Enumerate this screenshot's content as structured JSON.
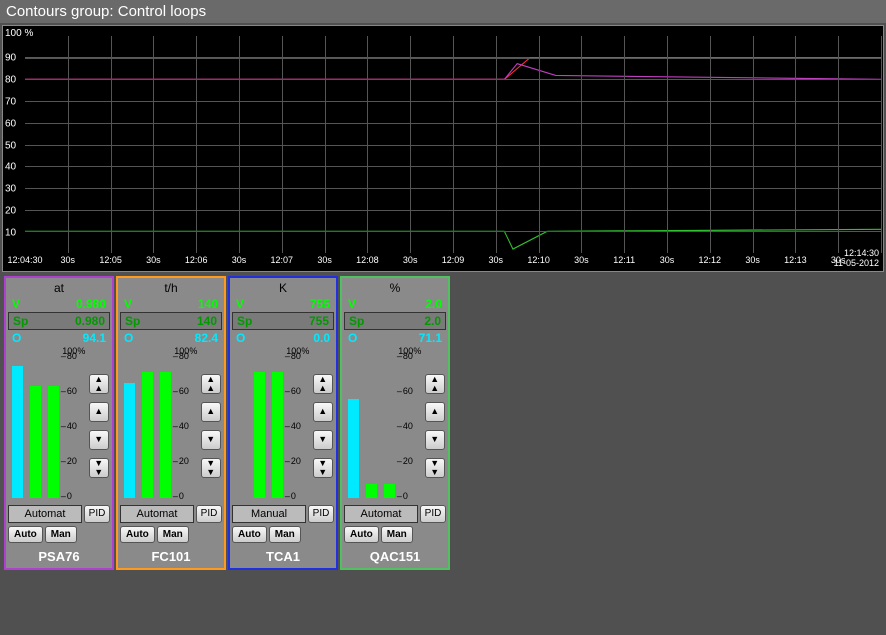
{
  "title": "Contours group: Control loops",
  "chart": {
    "yunit": "100 %",
    "yticks": [
      "90",
      "80",
      "70",
      "60",
      "50",
      "40",
      "30",
      "20",
      "10"
    ],
    "xticks": [
      "12:04:30",
      "30s",
      "12:05",
      "30s",
      "12:06",
      "30s",
      "12:07",
      "30s",
      "12:08",
      "30s",
      "12:09",
      "30s",
      "12:10",
      "30s",
      "12:11",
      "30s",
      "12:12",
      "30s",
      "12:13",
      "30s",
      "12:14:30"
    ],
    "date": "11-05-2012"
  },
  "chart_data": {
    "type": "line",
    "x_range": [
      "12:04:30",
      "12:14:30"
    ],
    "y_range": [
      0,
      100
    ],
    "ylabel": "%",
    "series": [
      {
        "name": "blue",
        "color": "#3050ff",
        "approx": [
          {
            "t": "12:04:30",
            "v": 90
          },
          {
            "t": "12:14:30",
            "v": 90
          }
        ]
      },
      {
        "name": "red",
        "color": "#ff3030",
        "approx": [
          {
            "t": "12:04:30",
            "v": 80
          },
          {
            "t": "12:10:00",
            "v": 80
          },
          {
            "t": "12:10:30",
            "v": 90
          },
          {
            "t": "12:14:30",
            "v": 90
          }
        ]
      },
      {
        "name": "magenta",
        "color": "#c040c0",
        "approx": [
          {
            "t": "12:04:30",
            "v": 80
          },
          {
            "t": "12:10:00",
            "v": 80
          },
          {
            "t": "12:10:20",
            "v": 87
          },
          {
            "t": "12:11:00",
            "v": 81
          },
          {
            "t": "12:14:30",
            "v": 80
          }
        ]
      },
      {
        "name": "green",
        "color": "#30c030",
        "approx": [
          {
            "t": "12:04:30",
            "v": 10
          },
          {
            "t": "12:10:00",
            "v": 10
          },
          {
            "t": "12:10:10",
            "v": 2
          },
          {
            "t": "12:10:40",
            "v": 10
          },
          {
            "t": "12:14:30",
            "v": 10
          }
        ]
      }
    ]
  },
  "panels": [
    {
      "name": "PSA76",
      "border": "#b040d0",
      "unit": "at",
      "V": "0.980",
      "Sp": "0.980",
      "O": "94.1",
      "bars": {
        "cyan": 94,
        "g1": 80,
        "g2": 80
      },
      "mode": "Automat"
    },
    {
      "name": "FC101",
      "border": "#ff9a1f",
      "unit": "t/h",
      "V": "140",
      "Sp": "140",
      "O": "82.4",
      "bars": {
        "cyan": 82,
        "g1": 90,
        "g2": 90
      },
      "mode": "Automat"
    },
    {
      "name": "TCA1",
      "border": "#2030e0",
      "unit": "K",
      "V": "755",
      "Sp": "755",
      "O": "0.0",
      "bars": {
        "cyan": 0,
        "g1": 90,
        "g2": 90
      },
      "mode": "Manual"
    },
    {
      "name": "QAC151",
      "border": "#50c060",
      "unit": "%",
      "V": "2.0",
      "Sp": "2.0",
      "O": "71.1",
      "bars": {
        "cyan": 71,
        "g1": 10,
        "g2": 10
      },
      "mode": "Automat"
    }
  ],
  "labels": {
    "scale_top": "100%",
    "scale_ticks": [
      "80",
      "60",
      "40",
      "20",
      "0"
    ],
    "pid": "PID",
    "auto": "Auto",
    "man": "Man",
    "V": "V",
    "Sp": "Sp",
    "O": "O"
  }
}
